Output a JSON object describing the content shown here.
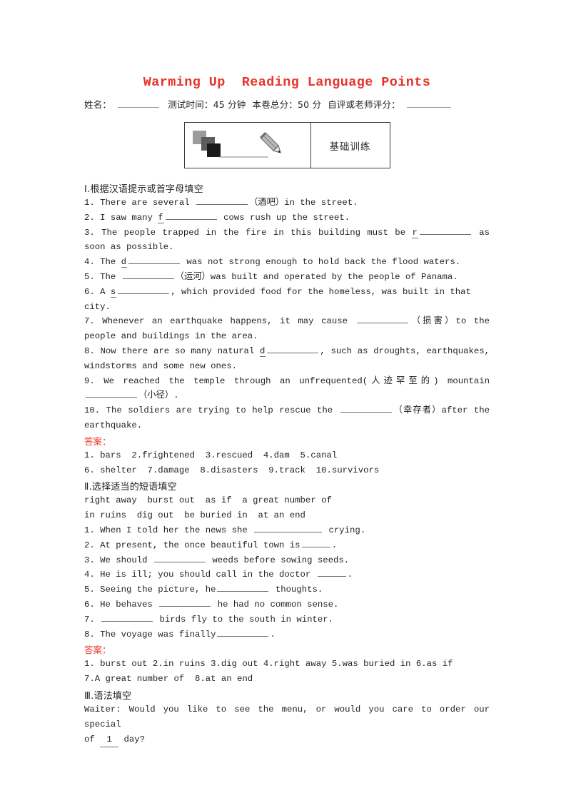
{
  "document": {
    "title": "Warming Up  Reading Language Points",
    "title_color": "#e8332a",
    "answer_label_color": "#e8332a"
  },
  "meta": {
    "name_label": "姓名：",
    "time_label": "测试时间：45 分钟",
    "total_label": "本卷总分：50 分",
    "score_label": "自评或老师评分："
  },
  "banner": {
    "icon_name": "pencil-squares-icon",
    "label": "基础训练"
  },
  "section1": {
    "heading": "Ⅰ.根据汉语提示或首字母填空",
    "items": [
      {
        "no": "1.",
        "before": "There are several ",
        "blank": "bl-l",
        "after": "（酒吧）in the street.",
        "seed": ""
      },
      {
        "no": "2.",
        "before": "I saw many ",
        "seed": "f",
        "blank": "bl-l",
        "after": " cows rush up the street.'"
      },
      {
        "no": "3.",
        "before": "The people trapped in the fire in this building must be ",
        "seed": "r",
        "blank": "bl-l",
        "after": " as soon as possible."
      },
      {
        "no": "4.",
        "before": "The ",
        "seed": "d",
        "blank": "bl-l",
        "after": " was not strong enough to hold back the flood waters."
      },
      {
        "no": "5.",
        "before": "The ",
        "blank": "bl-l",
        "after": "（运河）was built and operated by the people of Panama."
      },
      {
        "no": "6.",
        "before": "A ",
        "seed": "s",
        "blank": "bl-l",
        "after": ", which provided food for the homeless, was built in that city."
      },
      {
        "no": "7.",
        "before": "Whenever an earthquake happens, it may cause ",
        "blank": "bl-l",
        "after": "（损害）to the people and buildings in the area."
      },
      {
        "no": "8.",
        "before": "Now there are so many natural ",
        "seed": "d",
        "blank": "bl-l",
        "after": ", such as droughts, earthquakes, windstorms and some new ones."
      },
      {
        "no": "9.",
        "before": "We reached the temple through an unfrequented(人迹罕至的) mountain ",
        "blank": "bl-l",
        "after": "（小径）."
      },
      {
        "no": "10.",
        "before": "The soldiers are trying to help rescue the ",
        "blank": "bl-l",
        "after": "（幸存者）after the earthquake."
      }
    ],
    "answer_label": "答案：",
    "answers_line1": "1. bars  2.frightened  3.rescued  4.dam  5.canal",
    "answers_line2": "6. shelter  7.damage  8.disasters  9.track  10.survivors"
  },
  "section2": {
    "heading": "Ⅱ.选择适当的短语填空",
    "wordbank_line1": "right away  burst out  as if  a great number of",
    "wordbank_line2": "in ruins  dig out  be buried in  at an end",
    "items": [
      {
        "no": "1.",
        "before": "When I told her the news she ",
        "blank": "bl-xl",
        "after": " crying."
      },
      {
        "no": "2.",
        "before": "At present, the once beautiful town is",
        "blank": "bl-s",
        "after": "."
      },
      {
        "no": "3.",
        "before": "We should ",
        "blank": "bl-l",
        "after": " weeds before sowing seeds."
      },
      {
        "no": "4.",
        "before": "He is ill; you should call in the doctor ",
        "blank": "bl-s",
        "after": "."
      },
      {
        "no": "5.",
        "before": "Seeing the picture, he",
        "blank": "bl-l",
        "after": " thoughts."
      },
      {
        "no": "6.",
        "before": "He behaves ",
        "blank": "bl-l",
        "after": " he had no common sense."
      },
      {
        "no": "7.",
        "before": "",
        "blank": "bl-l",
        "after": " birds fly to the south in winter."
      },
      {
        "no": "8.",
        "before": "The voyage was finally",
        "blank": "bl-l",
        "after": "."
      }
    ],
    "answer_label": "答案：",
    "answers_line1": "1. burst out 2.in ruins 3.dig out 4.right away 5.was buried in 6.as if",
    "answers_line2": "7.A great number of  8.at an end"
  },
  "section3": {
    "heading": "Ⅲ.语法填空",
    "dialogue_line1": "Waiter: Would you like to see the menu, or would you care to order our special",
    "dialogue_line2_before": "of ",
    "dialogue_blank_value": "1",
    "dialogue_line2_after": " day?"
  }
}
